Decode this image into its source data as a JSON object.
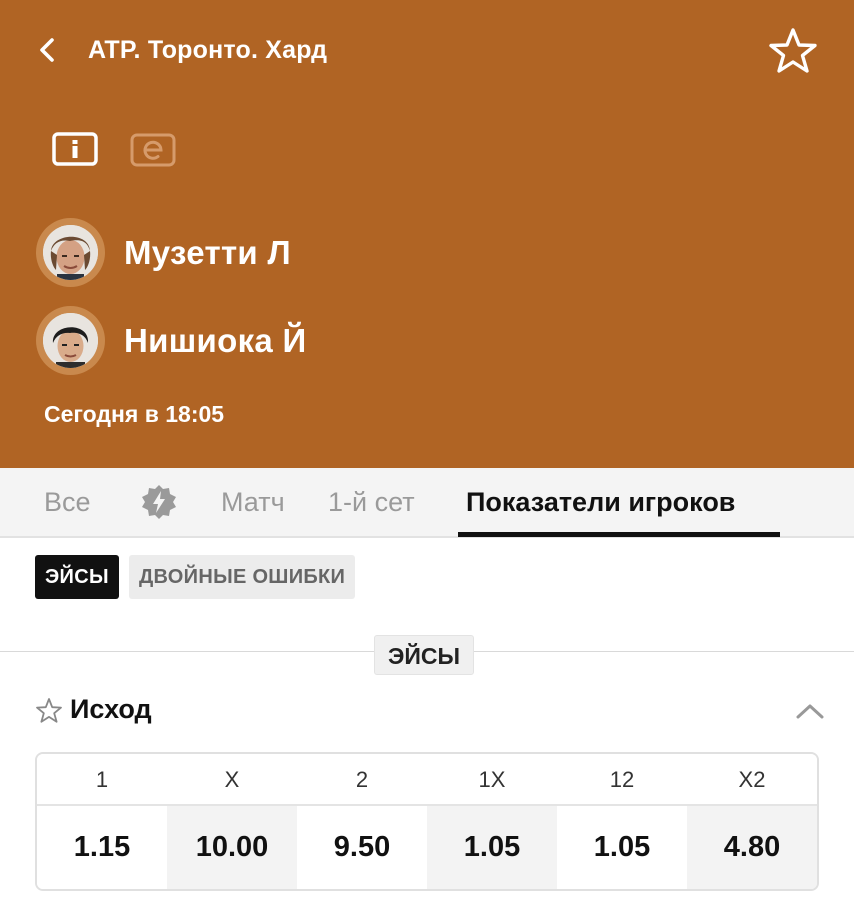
{
  "header": {
    "title": "ATP. Торонто. Хард",
    "match_time": "Сегодня в 18:05",
    "background_color": "#b06424",
    "icons": [
      "back-arrow-icon",
      "favorite-star-icon",
      "info-icon",
      "e-icon"
    ]
  },
  "players": [
    {
      "name": "Музетти Л"
    },
    {
      "name": "Нишиока Й"
    }
  ],
  "tabs": [
    {
      "label": "Все",
      "active": false
    },
    {
      "label": "",
      "icon": "lightning-badge-icon",
      "active": false
    },
    {
      "label": "Матч",
      "active": false
    },
    {
      "label": "1-й сет",
      "active": false
    },
    {
      "label": "Показатели игроков",
      "active": true
    }
  ],
  "filters": [
    {
      "label": "ЭЙСЫ",
      "active": true
    },
    {
      "label": "ДВОЙНЫЕ ОШИБКИ",
      "active": false
    }
  ],
  "section": {
    "label": "ЭЙСЫ"
  },
  "market": {
    "title": "Исход",
    "columns": [
      {
        "label": "1",
        "odds": "1.15"
      },
      {
        "label": "X",
        "odds": "10.00"
      },
      {
        "label": "2",
        "odds": "9.50"
      },
      {
        "label": "1X",
        "odds": "1.05"
      },
      {
        "label": "12",
        "odds": "1.05"
      },
      {
        "label": "X2",
        "odds": "4.80"
      }
    ]
  }
}
